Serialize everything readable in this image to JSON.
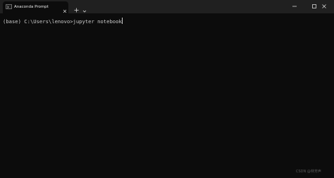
{
  "window": {
    "tab_title": "Anaconda Prompt",
    "icons": {
      "tab": "terminal-icon",
      "tab_close": "close-icon",
      "new_tab": "plus-icon",
      "dropdown": "chevron-down-icon",
      "minimize": "minimize-icon",
      "maximize": "maximize-icon",
      "close": "close-icon"
    }
  },
  "terminal": {
    "prompt": "(base) C:\\Users\\lenovo>",
    "command": "jupyter notebook"
  },
  "watermark": "CSDN @林芳声",
  "colors": {
    "background": "#0c0c0c",
    "titlebar": "#202020",
    "text": "#cccccc"
  }
}
